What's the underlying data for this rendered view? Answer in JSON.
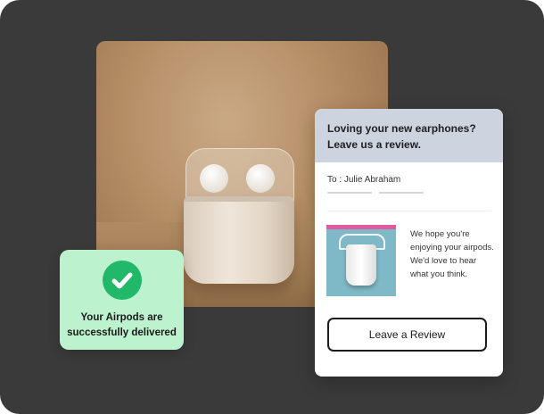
{
  "delivery": {
    "message": "Your Airpods are successfully delivered",
    "icon": "check-circle-icon",
    "accent": "#22b86a",
    "background": "#bdf2cf"
  },
  "email": {
    "header_title": "Loving your new earphones? Leave us a review.",
    "header_background": "#cdd3df",
    "to_line": "To : Julie Abraham",
    "body_text": "We hope you're enjoying your airpods. We'd love to hear what you think.",
    "button_label": "Leave a Review"
  }
}
